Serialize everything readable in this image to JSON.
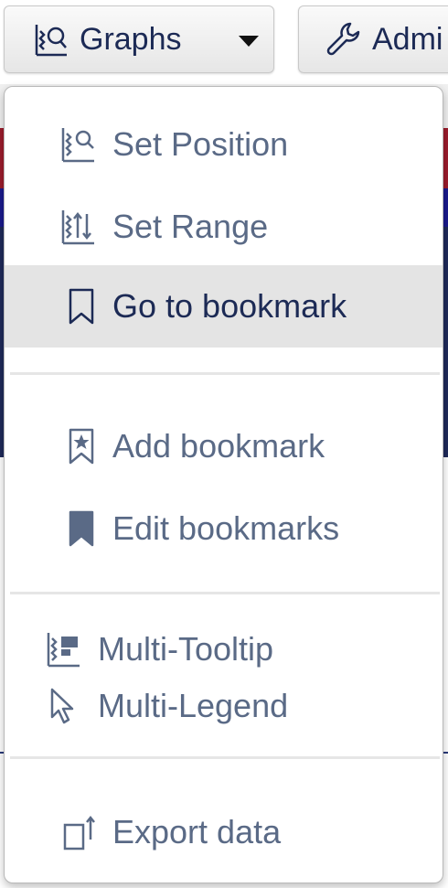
{
  "toolbar": {
    "graphs_label": "Graphs",
    "admin_label": "Admi"
  },
  "menu": {
    "items": [
      {
        "label": "Set Position",
        "icon": "set-position-icon"
      },
      {
        "label": "Set Range",
        "icon": "set-range-icon"
      },
      {
        "label": "Go to bookmark",
        "icon": "bookmark-icon",
        "active": true
      },
      {
        "label": "Add bookmark",
        "icon": "add-bookmark-icon"
      },
      {
        "label": "Edit bookmarks",
        "icon": "edit-bookmarks-icon"
      },
      {
        "label": "Multi-Tooltip",
        "icon": "multi-tooltip-icon"
      },
      {
        "label": "Multi-Legend",
        "icon": "cursor-icon"
      },
      {
        "label": "Export data",
        "icon": "export-icon"
      }
    ]
  },
  "colors": {
    "text": "#5a6a86",
    "text_active": "#1c2a55",
    "active_bg": "#e4e4e4"
  }
}
